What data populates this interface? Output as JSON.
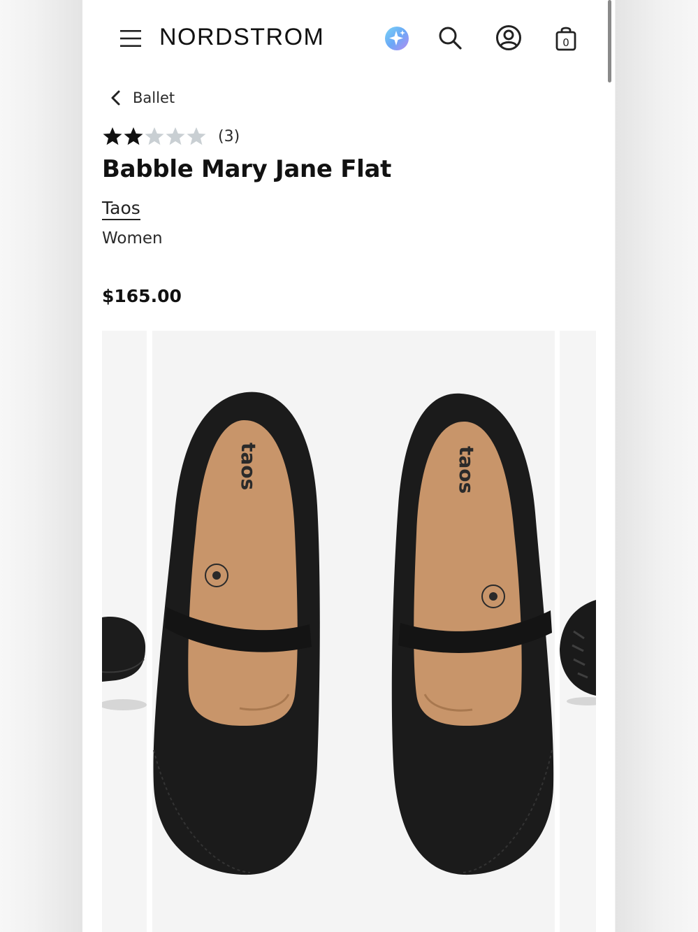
{
  "header": {
    "logo": "NORDSTROM",
    "bag_count": "0"
  },
  "breadcrumb": {
    "label": "Ballet"
  },
  "product": {
    "rating": 2,
    "rating_max": 5,
    "review_count": "(3)",
    "title": "Babble Mary Jane Flat",
    "brand": "Taos",
    "gender": "Women",
    "price": "$165.00"
  },
  "image": {
    "insole_brand": "taos"
  },
  "colors": {
    "star_filled": "#111111",
    "star_empty": "#c9cfd3",
    "shoe_leather": "#1b1b1b",
    "insole": "#c8956a"
  }
}
